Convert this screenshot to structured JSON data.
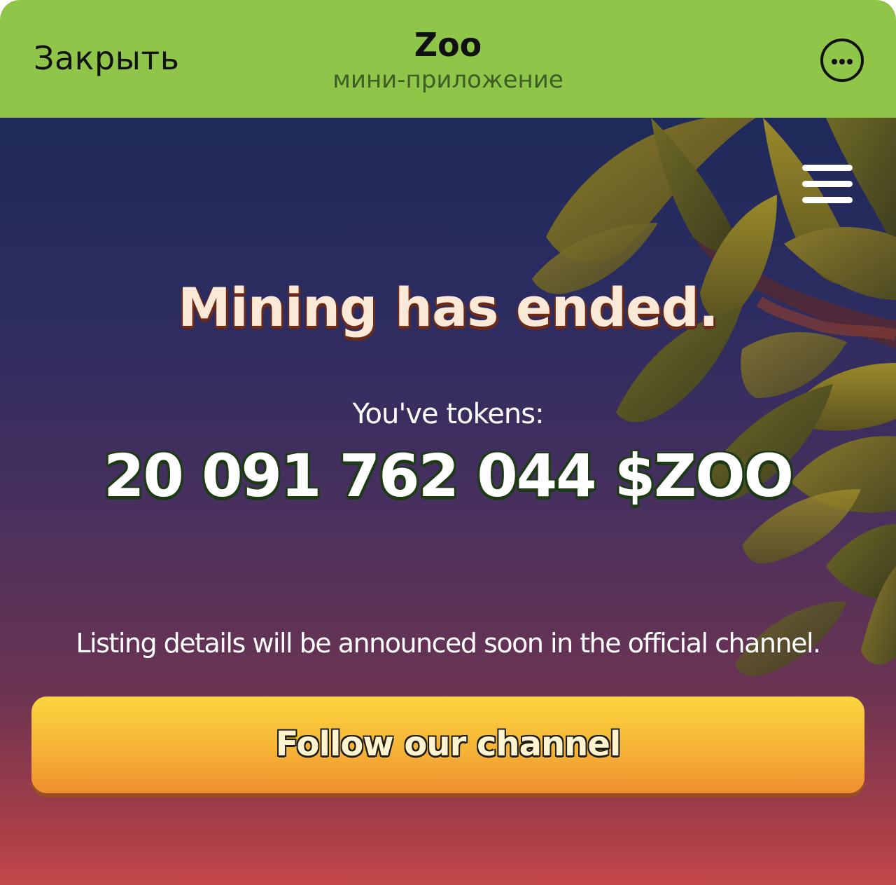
{
  "header": {
    "close_label": "Закрыть",
    "title": "Zoo",
    "subtitle": "мини-приложение",
    "more_icon": "more-horizontal-icon",
    "bar_color": "#8fc64a"
  },
  "game": {
    "menu_icon": "hamburger-menu-icon",
    "headline": "Mining has ended.",
    "tokens_label": "You've tokens:",
    "tokens_value": "20 091 762 044 $ZOO",
    "listing_note": "Listing details will be announced soon in the official channel.",
    "follow_button_label": "Follow our channel",
    "colors": {
      "button_gradient_top": "#fbd63f",
      "button_gradient_bottom": "#ef8f2e",
      "background_top": "#1f2a5a",
      "background_bottom": "#c5484a"
    }
  }
}
